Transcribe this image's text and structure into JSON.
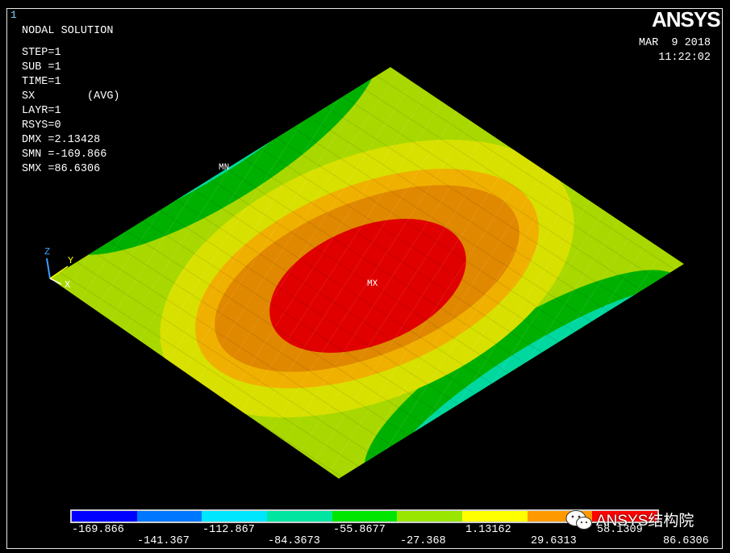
{
  "window": {
    "number": "1"
  },
  "logo": "ANSYS",
  "info": {
    "title": "NODAL SOLUTION",
    "lines": [
      "STEP=1",
      "SUB =1",
      "TIME=1",
      "SX        (AVG)",
      "LAYR=1",
      "RSYS=0",
      "DMX =2.13428",
      "SMN =-169.866",
      "SMX =86.6306"
    ]
  },
  "datetime": {
    "date": "MAR  9 2018",
    "time": "11:22:02"
  },
  "markers": {
    "min": "MN",
    "max": "MX"
  },
  "triad": {
    "z": "Z",
    "y": "Y",
    "x": "X"
  },
  "legend": {
    "colors": [
      "#0000ff",
      "#0077ff",
      "#00e6ff",
      "#00e6a0",
      "#00e600",
      "#99e600",
      "#ffff00",
      "#ff9900",
      "#ff0000"
    ],
    "top_labels": [
      "-169.866",
      "-112.867",
      "-55.8677",
      "1.13162",
      "58.1309"
    ],
    "bottom_labels": [
      "-141.367",
      "-84.3673",
      "-27.368",
      "29.6313",
      "86.6306"
    ]
  },
  "watermark": {
    "text": "ANSYS结构院",
    "icon": "wechat-icon"
  }
}
